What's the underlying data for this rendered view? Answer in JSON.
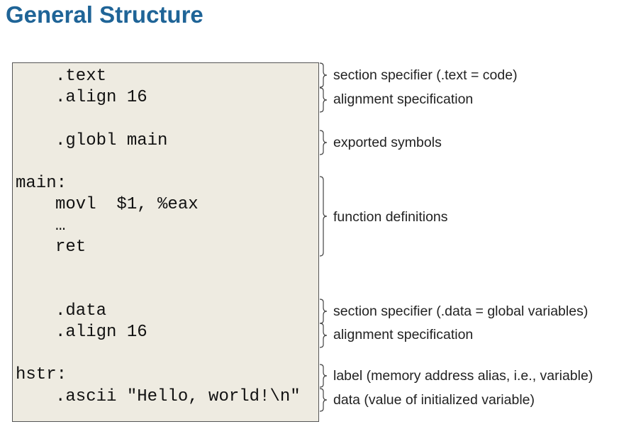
{
  "title": "General Structure",
  "code_lines": [
    ".text",
    ".align 16",
    ".globl main",
    "main:",
    "movl  $1, %eax",
    "…",
    "ret",
    ".data",
    ".align 16",
    "hstr:",
    ".ascii \"Hello, world!\\n\""
  ],
  "annotations": [
    "section specifier (.text = code)",
    "alignment specification",
    "exported symbols",
    "function definitions",
    "section specifier (.data = global variables)",
    "alignment specification",
    "label (memory address alias, i.e., variable)",
    "data (value of initialized variable)"
  ]
}
